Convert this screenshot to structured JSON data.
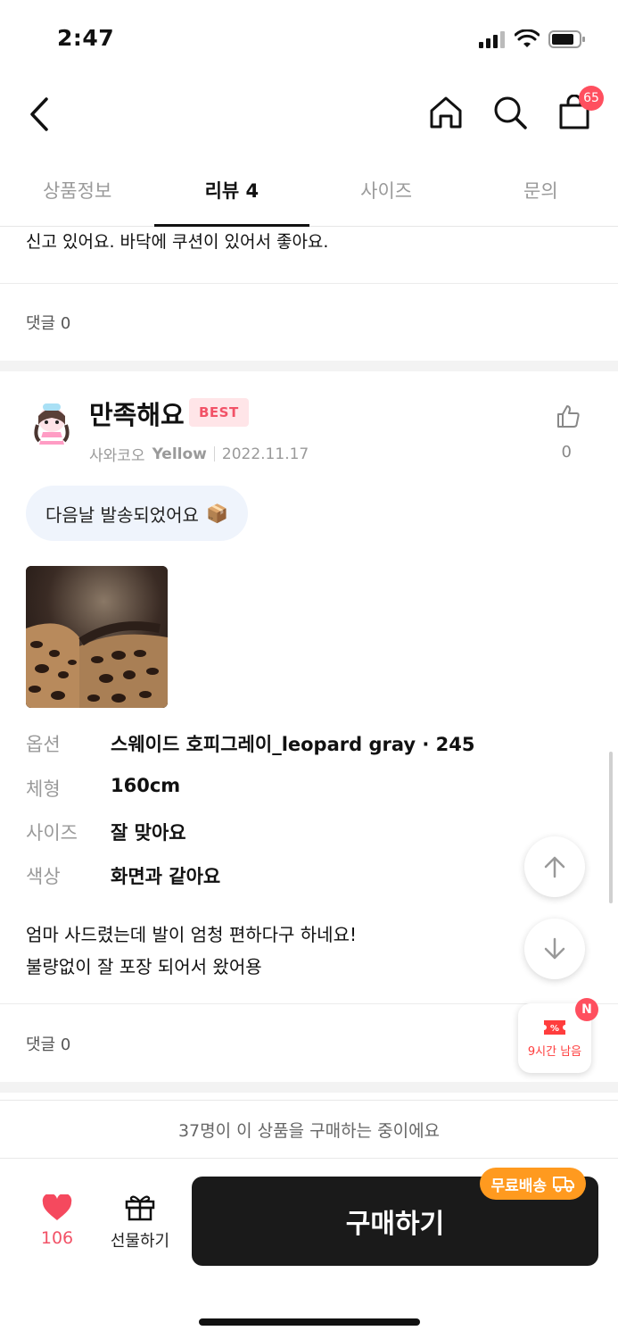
{
  "status_bar": {
    "time": "2:47"
  },
  "header": {
    "cart_count": "65"
  },
  "tabs": [
    {
      "label": "상품정보"
    },
    {
      "label": "리뷰 4"
    },
    {
      "label": "사이즈"
    },
    {
      "label": "문의"
    }
  ],
  "previous_review": {
    "text_tail": "신고 있어요. 바닥에 쿠션이 있어서 좋아요.",
    "comment_count": "댓글 0"
  },
  "review": {
    "title": "만족해요",
    "badge": "BEST",
    "reviewer": "사와코오",
    "level": "Yellow",
    "date": "2022.11.17",
    "like_count": "0",
    "chip_text": "다음날 발송되었어요",
    "chip_emoji": "📦",
    "specs": [
      {
        "label": "옵션",
        "value": "스웨이드 호피그레이_leopard gray · 245"
      },
      {
        "label": "체형",
        "value": "160cm"
      },
      {
        "label": "사이즈",
        "value": "잘 맞아요"
      },
      {
        "label": "색상",
        "value": "화면과 같아요"
      }
    ],
    "body_line1": "엄마 사드렸는데 발이 엄청 편하다구 하네요!",
    "body_line2": "불량없이 잘 포장 되어서 왔어용",
    "comment_count": "댓글 0"
  },
  "coupon": {
    "badge": "N",
    "text": "9시간 남음"
  },
  "purchase_info": "37명이 이 상품을 구매하는 중이에요",
  "bottom": {
    "wish_count": "106",
    "gift_label": "선물하기",
    "buy_label": "구매하기",
    "free_shipping": "무료배송"
  },
  "colors": {
    "accent_pink": "#f25267",
    "buy_button": "#1a1a1a",
    "free_shipping": "#ff9a1f"
  }
}
